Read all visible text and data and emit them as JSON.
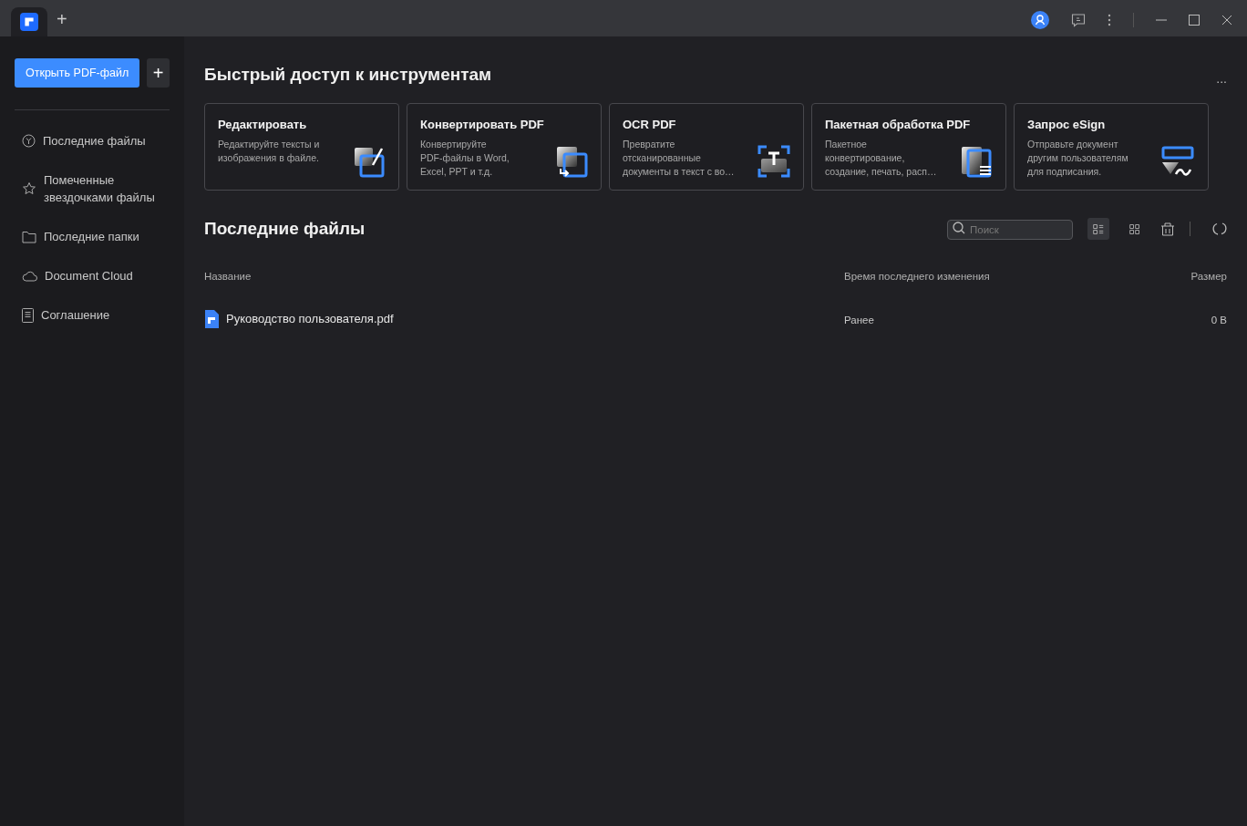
{
  "window": {
    "tabs": [
      {
        "kind": "app",
        "selected": true
      },
      {
        "kind": "new",
        "label": "+",
        "selected": false
      }
    ]
  },
  "sidebar": {
    "open_button": "Открыть PDF-файл",
    "add_button": "+",
    "items": [
      {
        "kind": "clock",
        "label": "Последние файлы"
      },
      {
        "kind": "star",
        "label": "Помеченные\nзвездочками файлы"
      },
      {
        "kind": "folder",
        "label": "Последние папки"
      },
      {
        "kind": "cloud",
        "label": "Document Cloud"
      },
      {
        "kind": "doc",
        "label": "Соглашение"
      }
    ]
  },
  "quick_tools": {
    "title": "Быстрый доступ к инструментам",
    "more": "...",
    "cards": [
      {
        "kind": "edit",
        "title": "Редактировать",
        "description": "Редактируйте тексты и\nизображения в файле."
      },
      {
        "kind": "convert",
        "title": "Конвертировать PDF",
        "description": "Конвертируйте\nPDF-файлы в Word,\nExcel, PPT и т.д."
      },
      {
        "kind": "ocr",
        "title": "OCR PDF",
        "description": "Превратите\nотсканированные\nдокументы в текст с во…"
      },
      {
        "kind": "batch",
        "title": "Пакетная обработка PDF",
        "description": "Пакетное\nконвертирование,\nсоздание, печать, расп…"
      },
      {
        "kind": "esign",
        "title": "Запрос eSign",
        "description": "Отправьте документ\nдругим пользователям\nдля подписания."
      }
    ]
  },
  "recent_files": {
    "title": "Последние файлы",
    "search": {
      "placeholder": "Поиск"
    },
    "views": [
      {
        "kind": "list",
        "selected": true
      },
      {
        "kind": "grid",
        "selected": false
      }
    ],
    "table": {
      "columns": [
        "Название",
        "Время последнего изменения",
        "Размер"
      ],
      "rows": [
        {
          "name": "Руководство пользователя.pdf",
          "modified": "Ранее",
          "size": "0 B"
        }
      ]
    }
  }
}
